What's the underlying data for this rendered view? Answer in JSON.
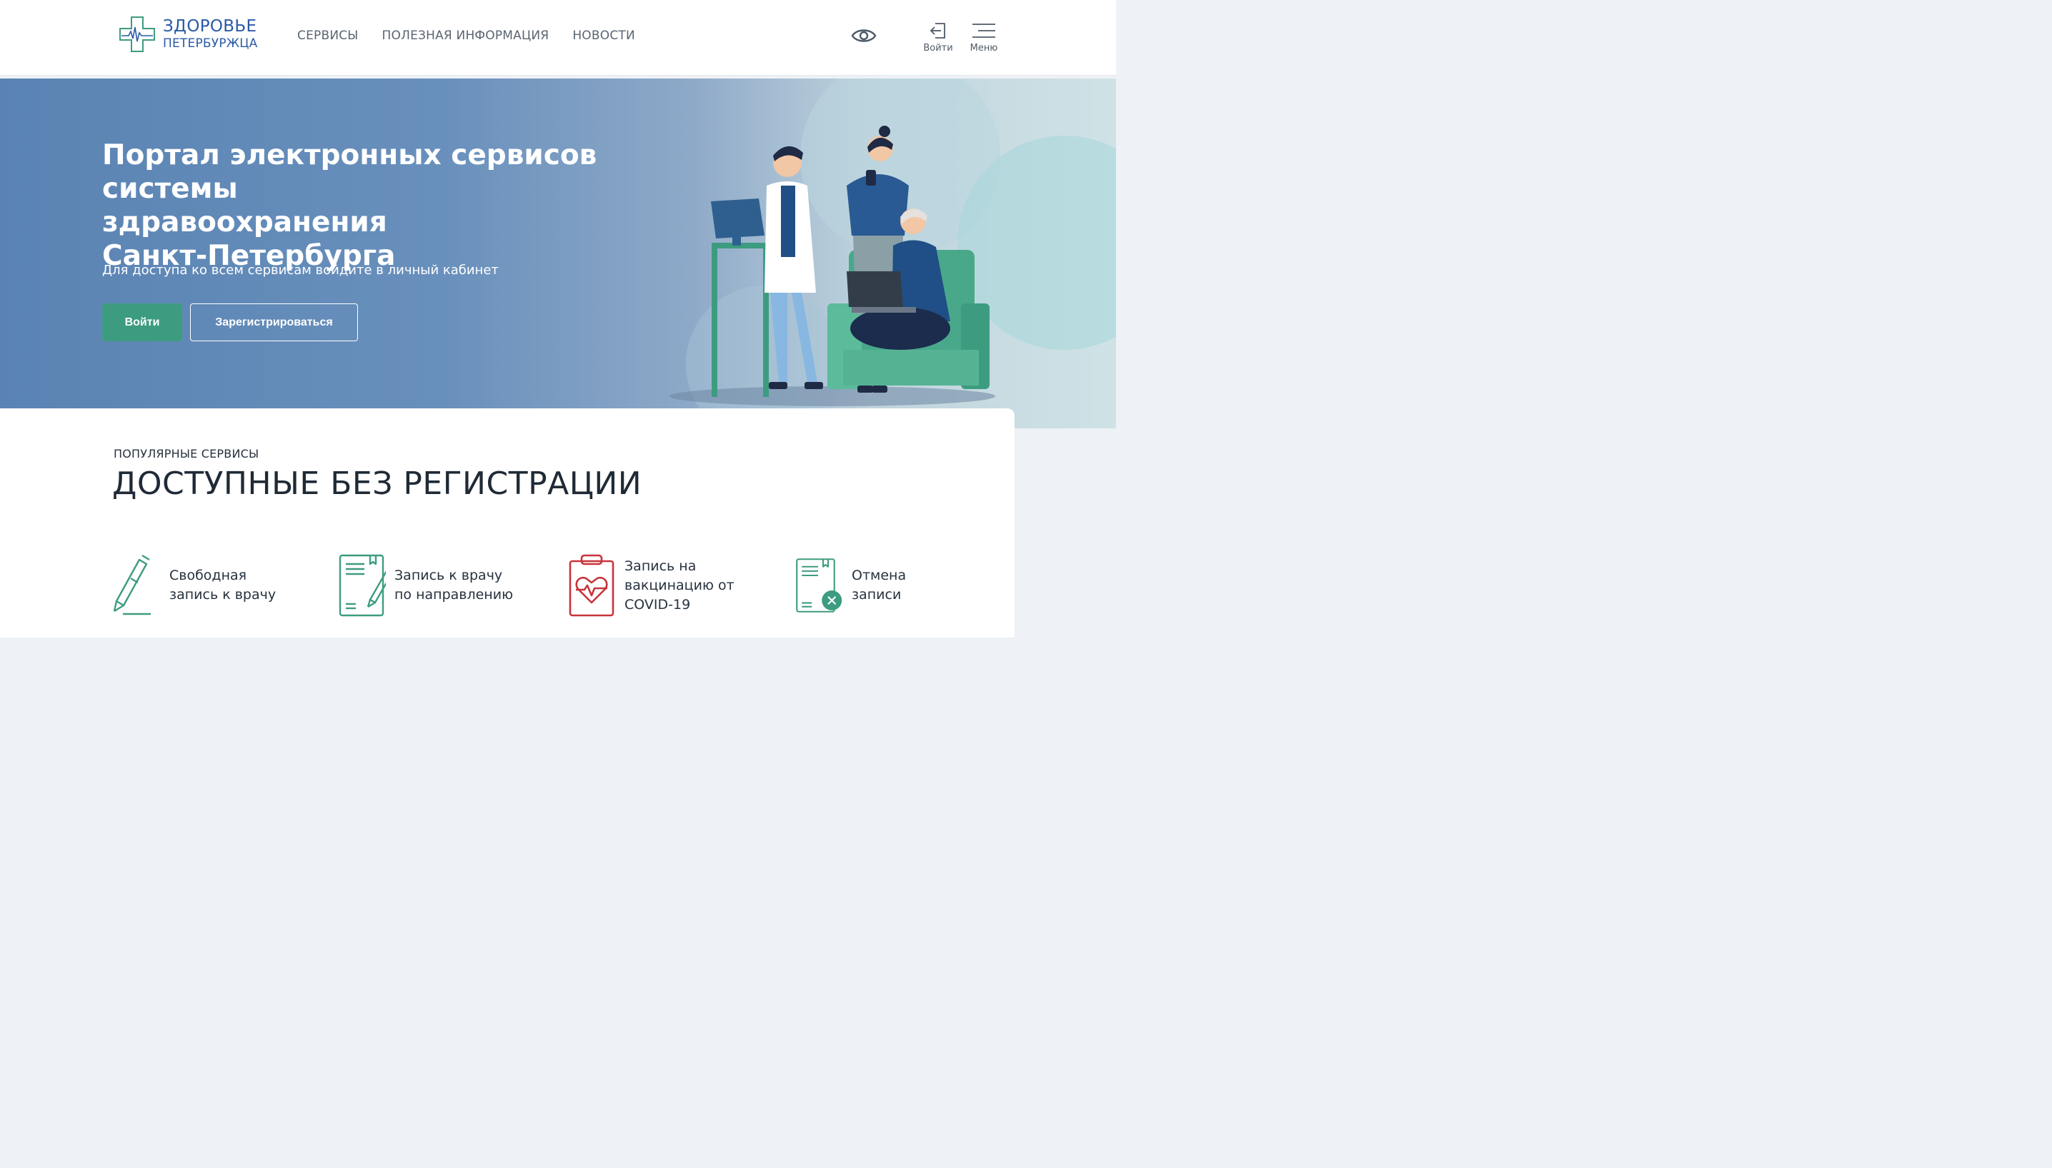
{
  "header": {
    "logo_line1": "ЗДОРОВЬЕ",
    "logo_line2": "ПЕТЕРБУРЖЦА",
    "nav": [
      "СЕРВИСЫ",
      "ПОЛЕЗНАЯ ИНФОРМАЦИЯ",
      "НОВОСТИ"
    ],
    "login_label": "Войти",
    "menu_label": "Меню"
  },
  "hero": {
    "title_lines": [
      "Портал электронных сервисов системы",
      "здравоохранения",
      "Санкт-Петербурга"
    ],
    "subtitle": "Для доступа ко всем сервисам войдите в личный кабинет",
    "login_button": "Войти",
    "register_button": "Зарегистрироваться"
  },
  "popular": {
    "kicker": "ПОПУЛЯРНЫЕ СЕРВИСЫ",
    "title": "ДОСТУПНЫЕ БЕЗ РЕГИСТРАЦИИ",
    "services": [
      {
        "lines": [
          "Свободная",
          "запись к врачу"
        ],
        "icon": "pen-icon"
      },
      {
        "lines": [
          "Запись к врачу",
          "по направлению"
        ],
        "icon": "document-pen-icon"
      },
      {
        "lines": [
          "Запись на",
          "вакцинацию от",
          "COVID-19"
        ],
        "icon": "clipboard-heart-icon"
      },
      {
        "lines": [
          "Отмена",
          "записи"
        ],
        "icon": "document-cancel-icon"
      }
    ]
  },
  "colors": {
    "brand_blue": "#2b5aa6",
    "accent_green": "#3d9c80",
    "covid_red": "#c8343a"
  }
}
